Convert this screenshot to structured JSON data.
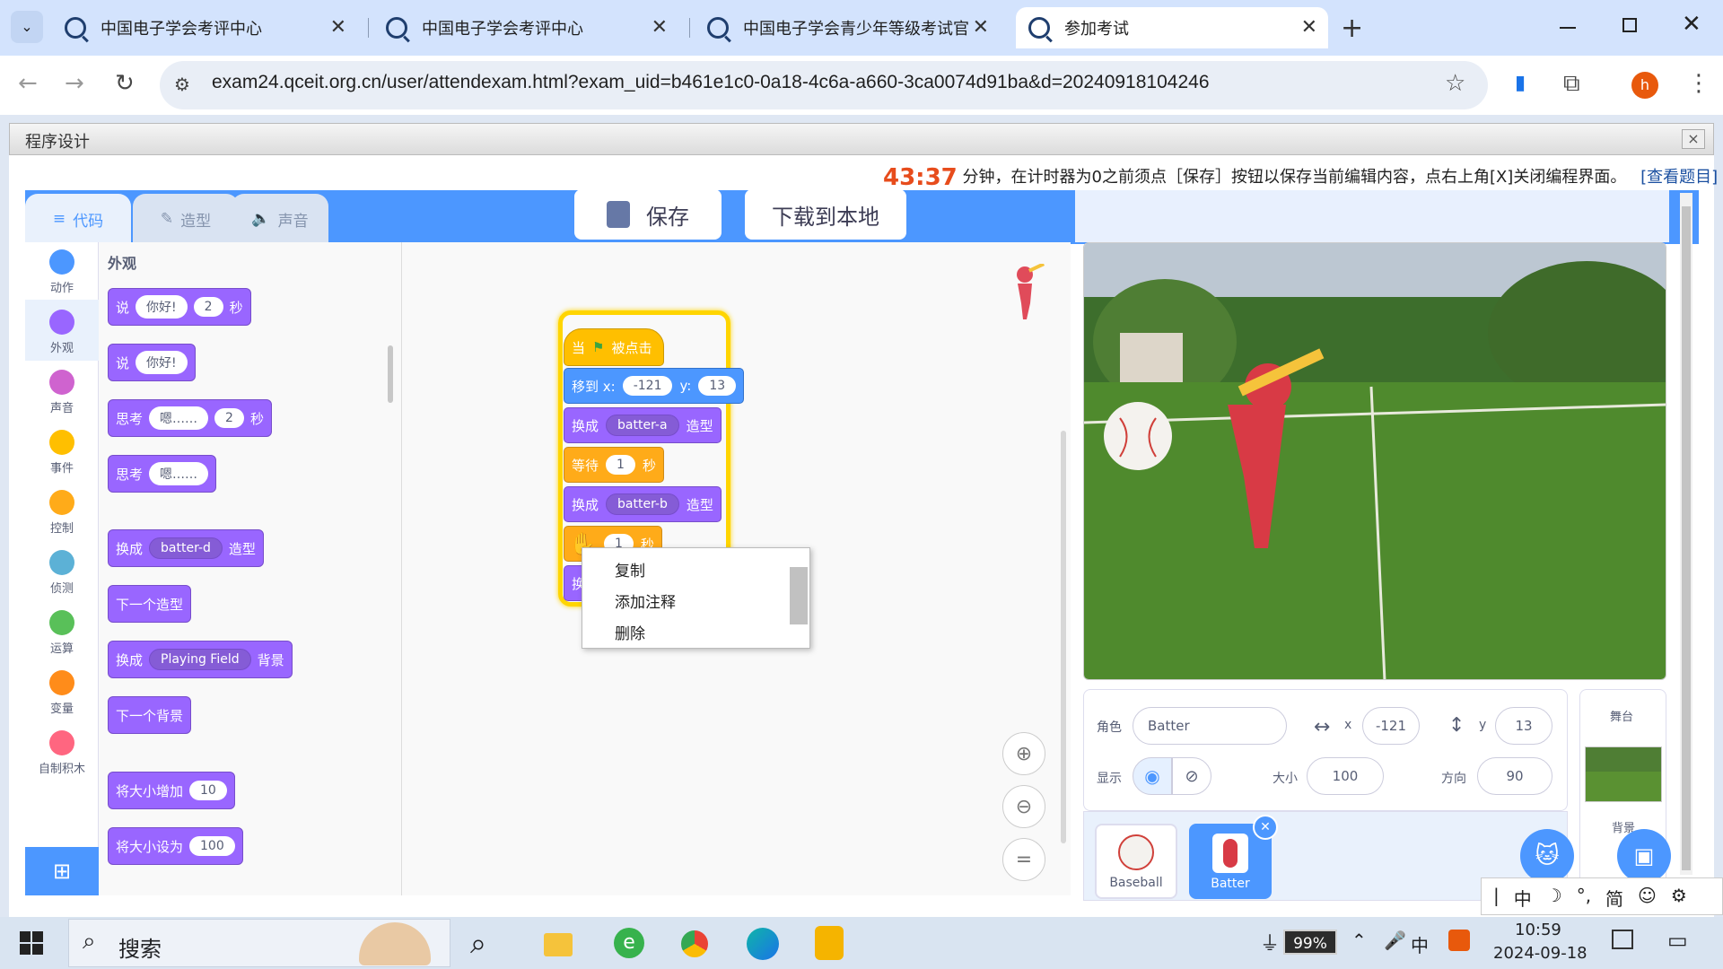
{
  "browser": {
    "tabs": [
      {
        "title": "中国电子学会考评中心"
      },
      {
        "title": "中国电子学会考评中心"
      },
      {
        "title": "中国电子学会青少年等级考试官"
      },
      {
        "title": "参加考试"
      }
    ],
    "new_tab_icon": "+",
    "url": "exam24.qceit.org.cn/user/attendexam.html?exam_uid=b461e1c0-0a18-4c6a-a660-3ca0074d91ba&d=20240918104246",
    "profile_initial": "h"
  },
  "exam": {
    "window_title": "程序设计",
    "close_label": "×",
    "timer": "43:37",
    "timer_message": "分钟，在计时器为0之前须点［保存］按钮以保存当前编辑内容，点右上角[X]关闭编程界面。",
    "view_question_link": "[查看题目]"
  },
  "scratch": {
    "tabs": {
      "code": "代码",
      "costume": "造型",
      "sound": "声音"
    },
    "save_label": "保存",
    "download_label": "下载到本地",
    "categories": [
      {
        "label": "动作",
        "color": "#4c97ff"
      },
      {
        "label": "外观",
        "color": "#9966ff"
      },
      {
        "label": "声音",
        "color": "#cf63cf"
      },
      {
        "label": "事件",
        "color": "#ffbf00"
      },
      {
        "label": "控制",
        "color": "#ffab19"
      },
      {
        "label": "侦测",
        "color": "#5cb1d6"
      },
      {
        "label": "运算",
        "color": "#59c059"
      },
      {
        "label": "变量",
        "color": "#ff8c1a"
      },
      {
        "label": "自制积木",
        "color": "#ff6680"
      }
    ],
    "palette_heading": "外观",
    "palette": {
      "say_secs": {
        "say": "说",
        "text": "你好!",
        "secs": "2",
        "unit": "秒"
      },
      "say": {
        "say": "说",
        "text": "你好!"
      },
      "think_secs": {
        "think": "思考",
        "text": "嗯……",
        "secs": "2",
        "unit": "秒"
      },
      "think": {
        "think": "思考",
        "text": "嗯……"
      },
      "switch_costume": {
        "label": "换成",
        "value": "batter-d",
        "suffix": "造型"
      },
      "next_costume": "下一个造型",
      "switch_backdrop": {
        "label": "换成",
        "value": "Playing Field",
        "suffix": "背景"
      },
      "next_backdrop": "下一个背景",
      "change_size": {
        "label": "将大小增加",
        "value": "10"
      },
      "set_size": {
        "label": "将大小设为",
        "value": "100"
      }
    },
    "script": {
      "hat": {
        "when": "当",
        "clicked": "被点击"
      },
      "goto": {
        "label": "移到 x:",
        "x": "-121",
        "ylabel": "y:",
        "y": "13"
      },
      "costume_a": {
        "label": "换成",
        "value": "batter-a",
        "suffix": "造型"
      },
      "wait1": {
        "label": "等待",
        "value": "1",
        "unit": "秒"
      },
      "costume_b": {
        "label": "换成",
        "value": "batter-b",
        "suffix": "造型"
      },
      "wait2": {
        "value": "1",
        "unit": "秒"
      },
      "partial": "换"
    },
    "context_menu": [
      "复制",
      "添加注释",
      "删除"
    ],
    "sprite_info": {
      "sprite_label": "角色",
      "sprite_name": "Batter",
      "x_label": "x",
      "x": "-121",
      "y_label": "y",
      "y": "13",
      "show_label": "显示",
      "size_label": "大小",
      "size": "100",
      "direction_label": "方向",
      "direction": "90"
    },
    "sprites": [
      {
        "name": "Baseball"
      },
      {
        "name": "Batter"
      }
    ],
    "stage_label": "舞台",
    "backdrop_label": "背景"
  },
  "taskbar": {
    "search_label": "搜索",
    "battery": "99%",
    "time": "10:59",
    "date": "2024-09-18",
    "ime_chars": [
      "中",
      "°,",
      "简"
    ],
    "ime_lang": "中"
  }
}
